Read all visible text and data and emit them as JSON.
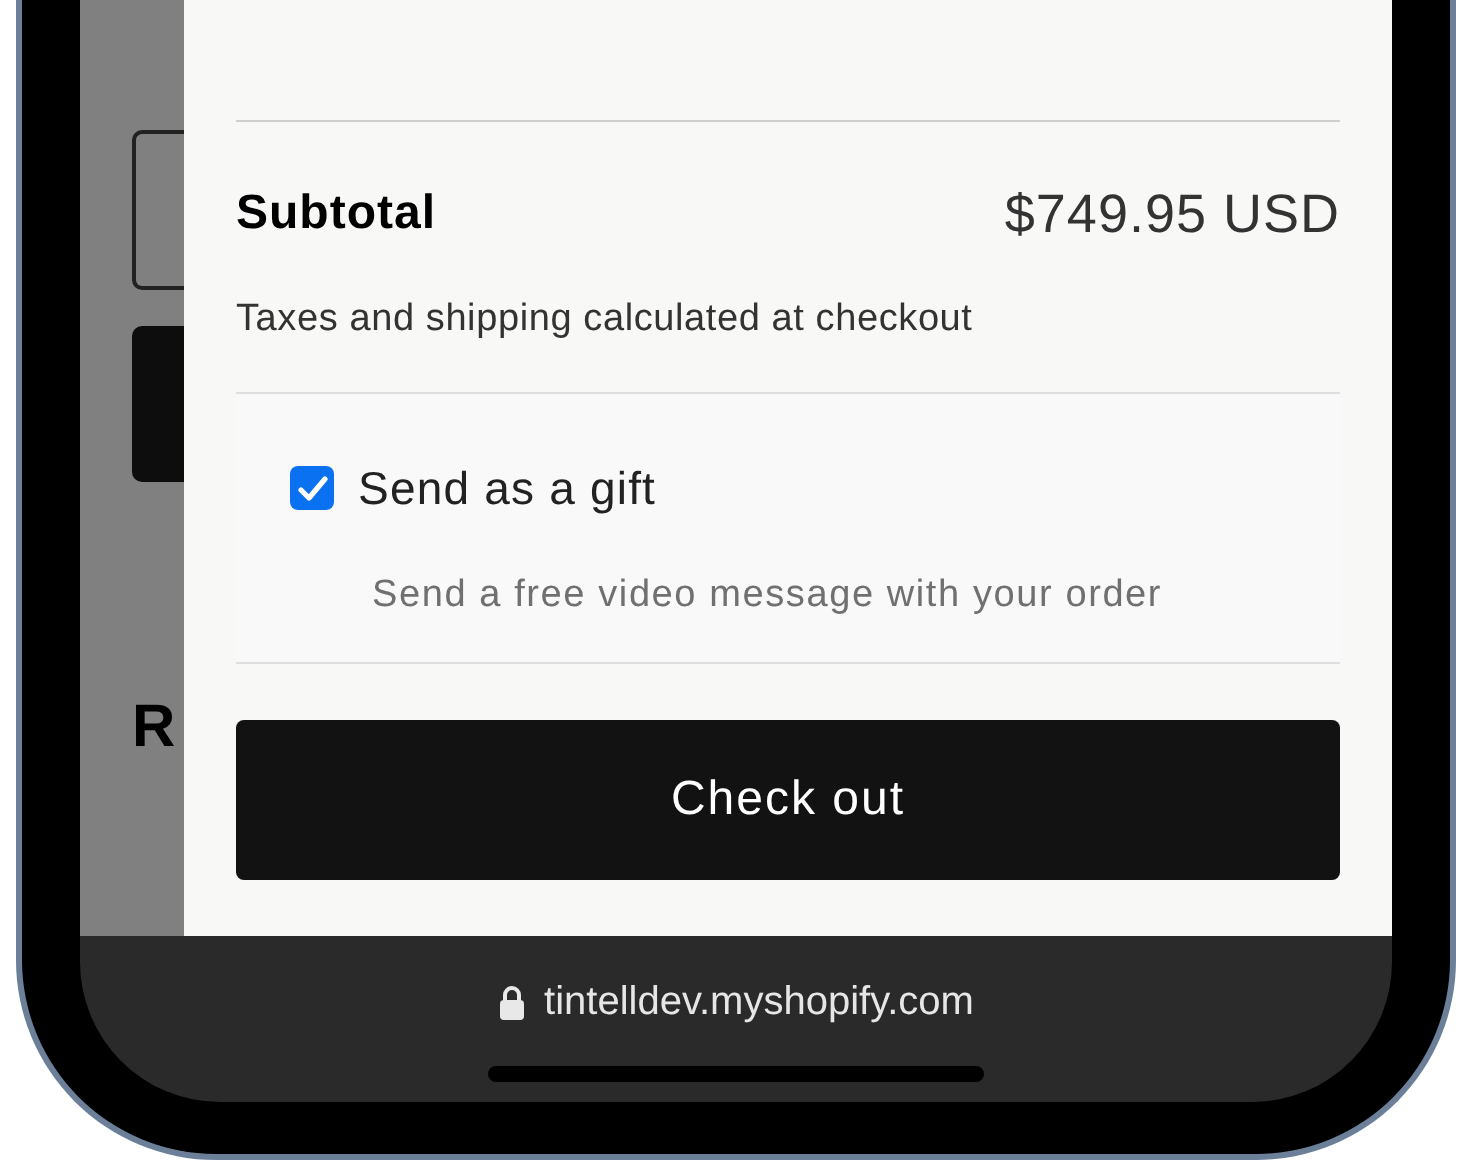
{
  "background_page": {
    "heading": "R"
  },
  "cart_drawer": {
    "subtotal_label": "Subtotal",
    "subtotal_value": "$749.95 USD",
    "note": "Taxes and shipping calculated at checkout",
    "gift_option": {
      "label": "Send as a gift",
      "checked": true,
      "description": "Send a free video message with your order"
    },
    "checkout_button": "Check out"
  },
  "browser_bar": {
    "url": "tintelldev.myshopify.com"
  }
}
